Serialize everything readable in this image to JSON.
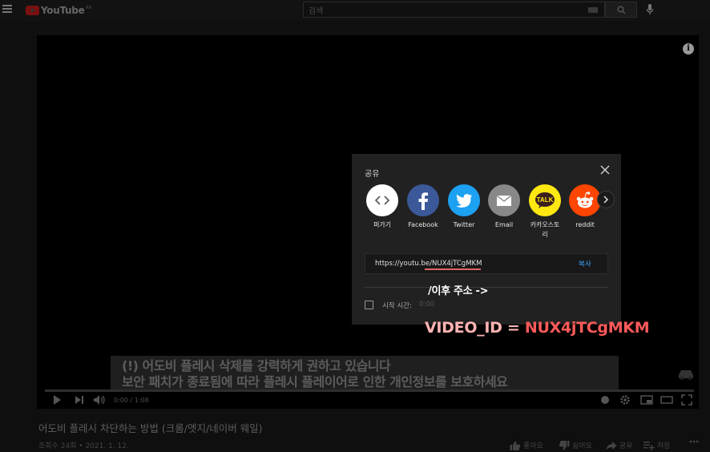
{
  "header": {
    "logo_text": "YouTube",
    "logo_region": "KR",
    "search_placeholder": "검색"
  },
  "player": {
    "subtitle_line1": "(!) 어도비 플레시 삭제를 강력하게 권하고 있습니다",
    "subtitle_line2": "보안 패치가 종료됨에 따라 플레시 플레이어로 인한 개인정보를 보호하세요",
    "time": "0:00 / 1:08",
    "progress": 0
  },
  "share_dialog": {
    "title": "공유",
    "items": [
      {
        "label": "퍼가기",
        "icon": "embed-icon",
        "color": "#ffffff"
      },
      {
        "label": "Facebook",
        "icon": "facebook-icon",
        "color": "#3b5998"
      },
      {
        "label": "Twitter",
        "icon": "twitter-icon",
        "color": "#1da1f2"
      },
      {
        "label": "Email",
        "icon": "email-icon",
        "color": "#888888"
      },
      {
        "label": "카카오스토리",
        "icon": "kakaotalk-icon",
        "color": "#ffe812"
      },
      {
        "label": "reddit",
        "icon": "reddit-icon",
        "color": "#ff4500"
      }
    ],
    "url_prefix": "https://youtu.be/",
    "url_id": "NUX4jTCgMKM",
    "copy_label": "복사",
    "start_time_label": "시작 시간:",
    "start_time_value": "0:00"
  },
  "annotations": {
    "arrow_note": "/이후 주소 ->",
    "video_id_key": "VIDEO_ID = ",
    "video_id_value": "NUX4jTCgMKM",
    "key_color": "#ffb3b3",
    "value_color": "#ff5a5a"
  },
  "video": {
    "title": "어도비 플레시 차단하는 방법 (크롬/엣지/네이버 웨일)",
    "meta": "조회수 24회 • 2021. 1. 12.",
    "like_label": "좋아요",
    "dislike_label": "싫어요",
    "share_label": "공유",
    "save_label": "저장"
  }
}
